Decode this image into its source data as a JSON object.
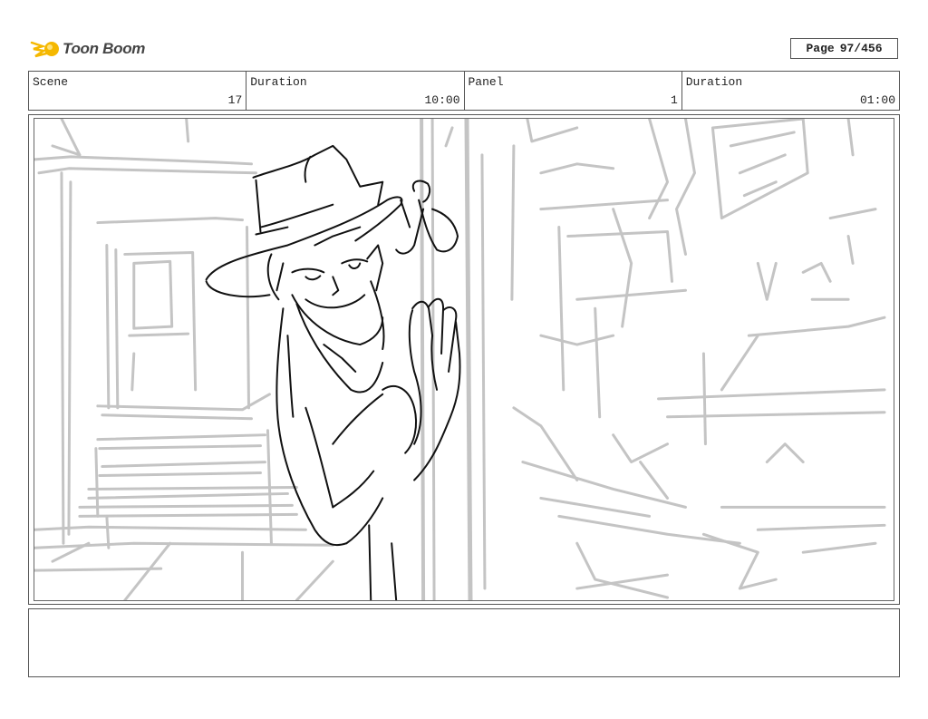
{
  "header": {
    "logo_text": "Toon Boom",
    "page_label": "Page",
    "page_number": "97/456"
  },
  "info": {
    "scene_label": "Scene",
    "scene_value": "17",
    "duration_label": "Duration",
    "duration_value": "10:00",
    "panel_label": "Panel",
    "panel_value": "1",
    "panel_duration_label": "Duration",
    "panel_duration_value": "01:00"
  },
  "colors": {
    "logo_yellow": "#f5b800",
    "sketch_gray": "#c4c4c4",
    "sketch_black": "#111111",
    "border": "#555555"
  },
  "notes": {
    "text": ""
  }
}
